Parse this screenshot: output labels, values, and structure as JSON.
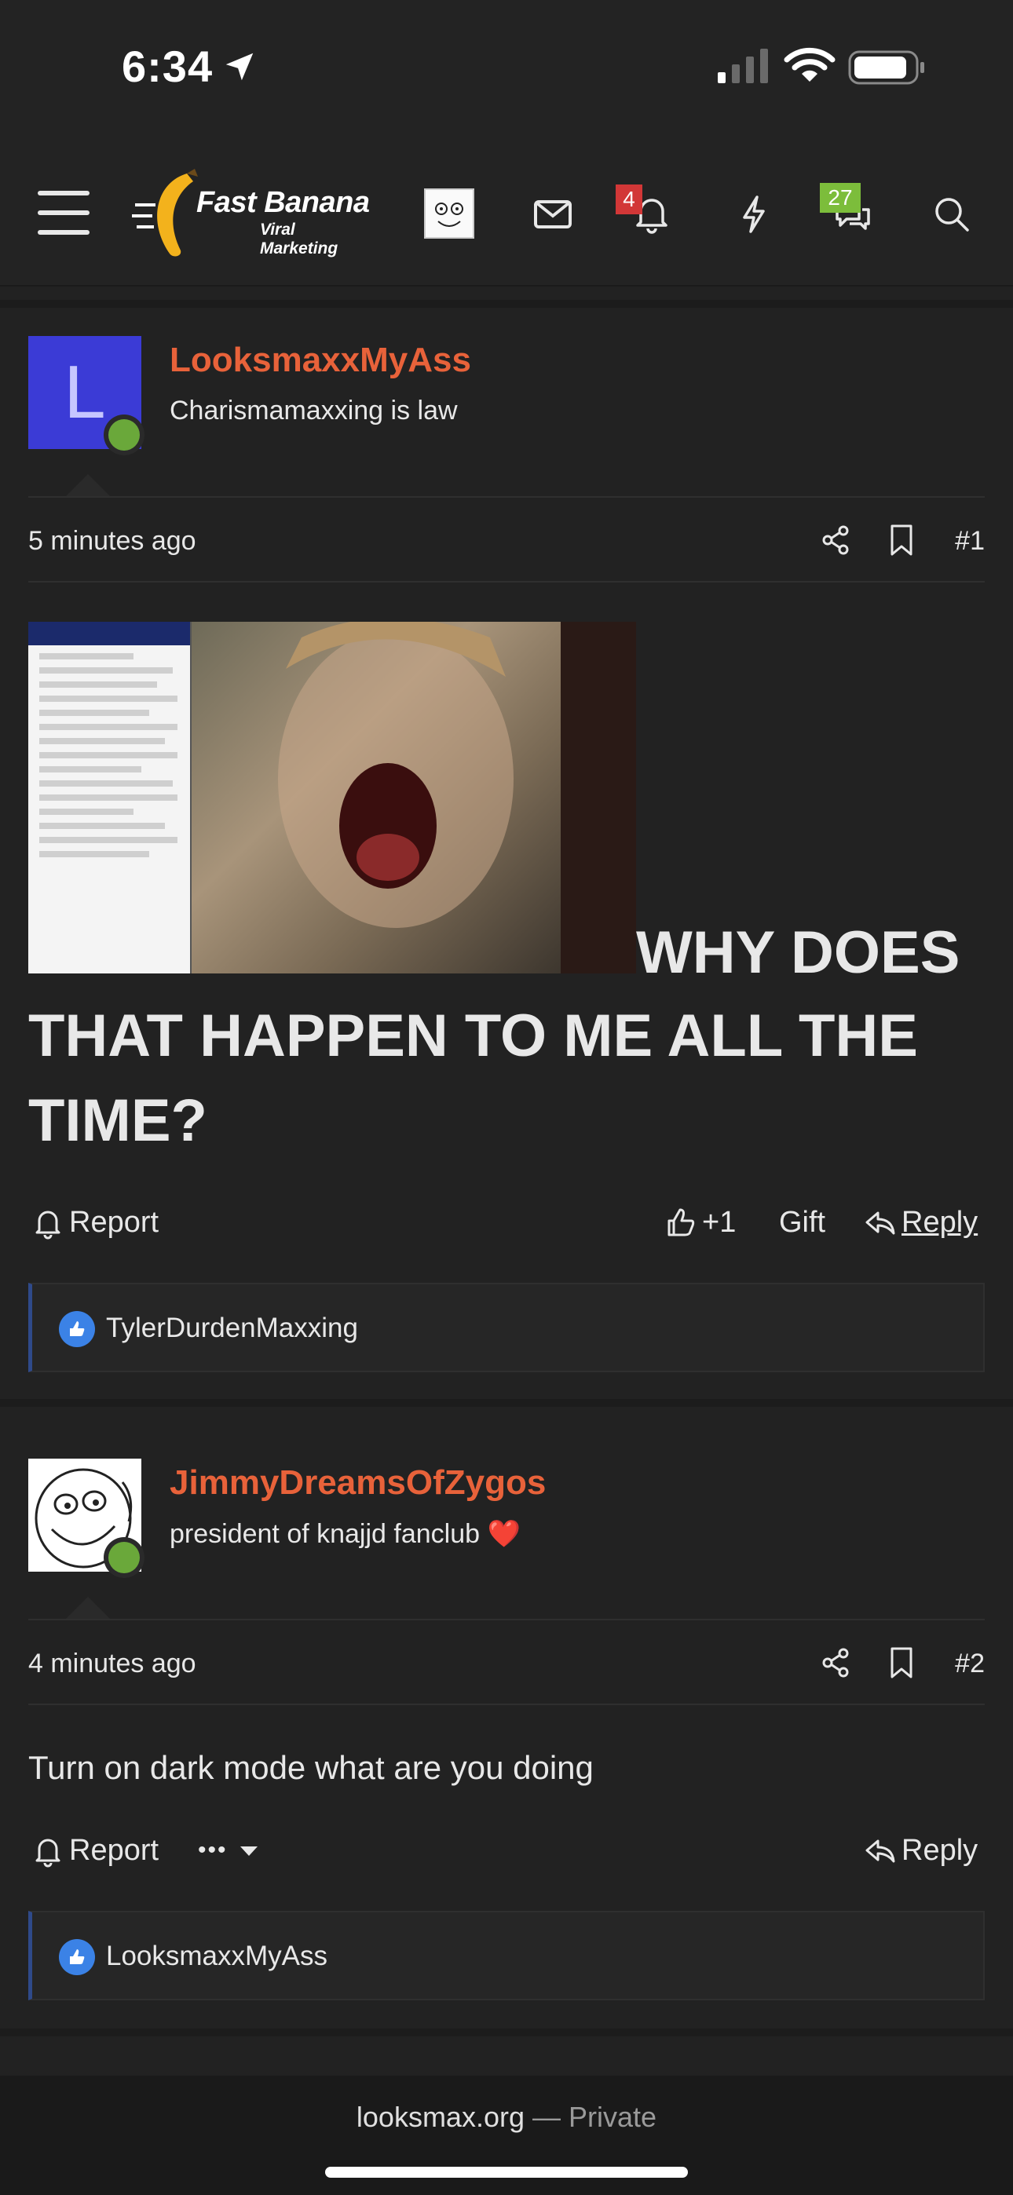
{
  "status_bar": {
    "time": "6:34"
  },
  "header": {
    "logo_name": "Fast Banana",
    "logo_tagline": "Viral Marketing",
    "alerts_count": "4",
    "conversations_count": "27"
  },
  "posts": [
    {
      "username": "LooksmaxxMyAss",
      "avatar_letter": "L",
      "user_title": "Charismamaxxing is law",
      "time": "5 minutes ago",
      "number": "#1",
      "body_line1": "WHY DOES",
      "body_line2": "THAT HAPPEN TO ME ALL THE",
      "body_line3": "TIME?",
      "report": "Report",
      "like_count": "+1",
      "gift": "Gift",
      "reply": "Reply",
      "liked_by": "TylerDurdenMaxxing"
    },
    {
      "username": "JimmyDreamsOfZygos",
      "user_title": "president of knajjd fanclub ❤️",
      "time": "4 minutes ago",
      "number": "#2",
      "body": "Turn on dark mode what are you doing",
      "report": "Report",
      "more": "•••",
      "reply": "Reply",
      "liked_by": "LooksmaxxMyAss"
    }
  ],
  "bottom_bar": {
    "domain": "looksmax.org",
    "separator": "—",
    "privacy": "Private"
  },
  "colors": {
    "username": "#e8623a",
    "badge_red": "#d23737",
    "badge_green": "#7cbd3b",
    "like_blue": "#3b82e6"
  }
}
